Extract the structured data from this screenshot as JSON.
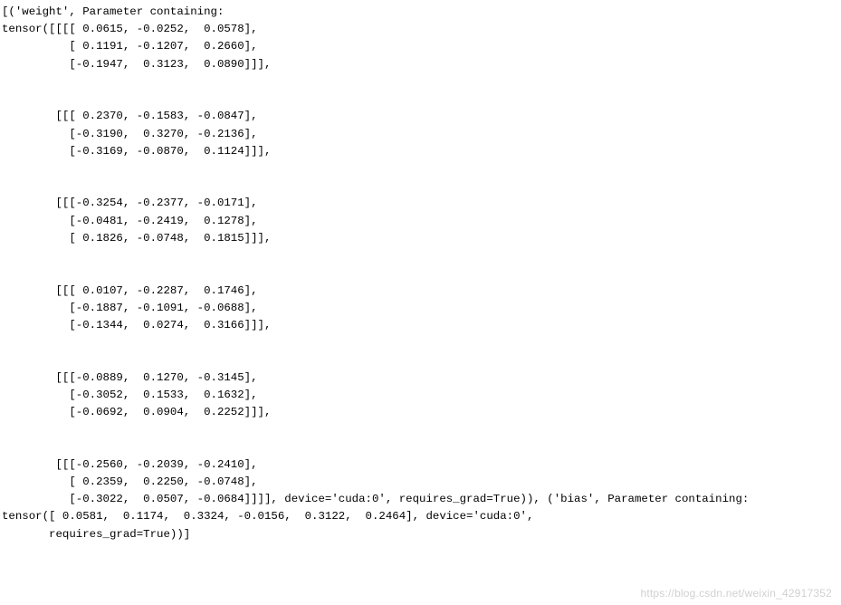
{
  "output": {
    "lines": [
      "[('weight', Parameter containing:",
      "tensor([[[[ 0.0615, -0.0252,  0.0578],",
      "          [ 0.1191, -0.1207,  0.2660],",
      "          [-0.1947,  0.3123,  0.0890]]],",
      "",
      "",
      "        [[[ 0.2370, -0.1583, -0.0847],",
      "          [-0.3190,  0.3270, -0.2136],",
      "          [-0.3169, -0.0870,  0.1124]]],",
      "",
      "",
      "        [[[-0.3254, -0.2377, -0.0171],",
      "          [-0.0481, -0.2419,  0.1278],",
      "          [ 0.1826, -0.0748,  0.1815]]],",
      "",
      "",
      "        [[[ 0.0107, -0.2287,  0.1746],",
      "          [-0.1887, -0.1091, -0.0688],",
      "          [-0.1344,  0.0274,  0.3166]]],",
      "",
      "",
      "        [[[-0.0889,  0.1270, -0.3145],",
      "          [-0.3052,  0.1533,  0.1632],",
      "          [-0.0692,  0.0904,  0.2252]]],",
      "",
      "",
      "        [[[-0.2560, -0.2039, -0.2410],",
      "          [ 0.2359,  0.2250, -0.0748],",
      "          [-0.3022,  0.0507, -0.0684]]]], device='cuda:0', requires_grad=True)), ('bias', Parameter containing:",
      "tensor([ 0.0581,  0.1174,  0.3324, -0.0156,  0.3122,  0.2464], device='cuda:0',",
      "       requires_grad=True))]"
    ]
  },
  "watermark": "https://blog.csdn.net/weixin_42917352"
}
